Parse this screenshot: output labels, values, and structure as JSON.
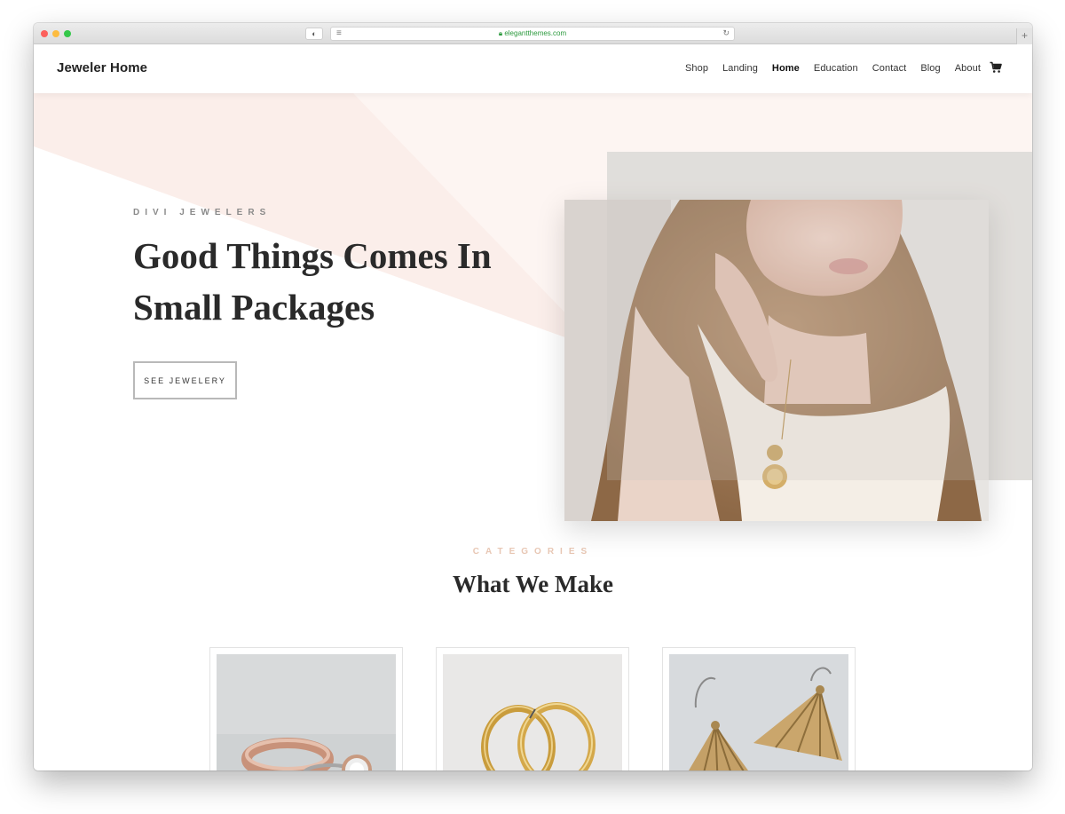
{
  "browser": {
    "url": "elegantthemes.com"
  },
  "site": {
    "logo": "Jeweler Home",
    "nav": [
      {
        "label": "Shop",
        "active": false
      },
      {
        "label": "Landing",
        "active": false
      },
      {
        "label": "Home",
        "active": true
      },
      {
        "label": "Education",
        "active": false
      },
      {
        "label": "Contact",
        "active": false
      },
      {
        "label": "Blog",
        "active": false
      },
      {
        "label": "About",
        "active": false
      }
    ],
    "cart_icon": "shopping-cart-icon"
  },
  "hero": {
    "eyebrow": "DIVI JEWELERS",
    "title": "Good Things Comes In Small Packages",
    "button_label": "SEE JEWELERY"
  },
  "categories": {
    "eyebrow": "CATEGORIES",
    "title": "What We Make"
  },
  "colors": {
    "accent_peach": "#e8c7b4",
    "hero_pink": "#fbefec",
    "text_dark": "#2a2a2a"
  }
}
